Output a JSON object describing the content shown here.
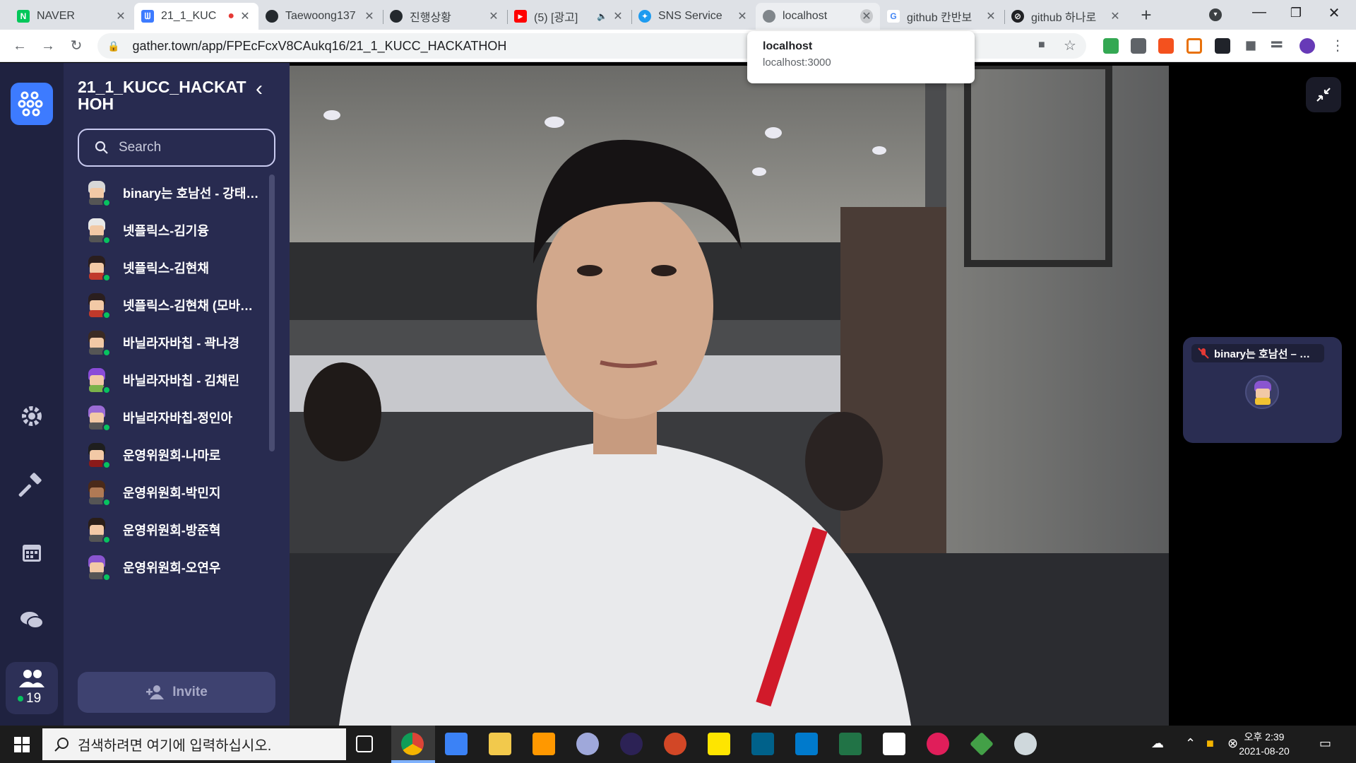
{
  "browser": {
    "tabs": [
      {
        "title": "NAVER",
        "favicon_color": "#03c75a",
        "favicon_glyph": "N"
      },
      {
        "title": "21_1_KUC",
        "favicon_color": "#3d7bff",
        "favicon_glyph": "ᗯ",
        "recording_indicator": "●"
      },
      {
        "title": "Taewoong137",
        "favicon_color": "#24292e",
        "favicon_glyph": "●"
      },
      {
        "title": "진행상황",
        "favicon_color": "#24292e",
        "favicon_glyph": "●"
      },
      {
        "title": "(5) [광고]",
        "favicon_color": "#ff0000",
        "favicon_glyph": "▶",
        "audio_icon": "🔈"
      },
      {
        "title": "SNS Service",
        "favicon_color": "#1d9bf0",
        "favicon_glyph": "✦"
      },
      {
        "title": "localhost",
        "favicon_color": "#80868b",
        "favicon_glyph": "◍"
      },
      {
        "title": "github 칸반보",
        "favicon_color": "#4285f4",
        "favicon_glyph": "G"
      },
      {
        "title": "github 하나로",
        "favicon_color": "#202124",
        "favicon_glyph": "⊘"
      }
    ],
    "new_tab_label": "+",
    "address": "gather.town/app/FPEcFcxV8CAukq16/21_1_KUCC_HACKATHOH",
    "hover_card": {
      "title": "localhost",
      "url": "localhost:3000"
    }
  },
  "gather": {
    "space_title": "21_1_KUCC_HACKATHOH",
    "search_placeholder": "Search",
    "online_count": "19",
    "invite_label": "Invite",
    "users": [
      {
        "name": "binary는 호남선 - 강태…",
        "hair": "#d7d7d7"
      },
      {
        "name": "넷플릭스-김기융",
        "hair": "#e8e8e8"
      },
      {
        "name": "넷플릭스-김현채",
        "hair": "#2a1e1e"
      },
      {
        "name": "넷플릭스-김현채 (모바…",
        "hair": "#2a1e1e"
      },
      {
        "name": "바닐라자바칩 - 곽나경",
        "hair": "#3a2a24"
      },
      {
        "name": "바닐라자바칩 - 김채린",
        "hair": "#8a4bd8"
      },
      {
        "name": "바닐라자바칩-정인아",
        "hair": "#9b6bd6"
      },
      {
        "name": "운영위원회-나마로",
        "hair": "#1e1e1e"
      },
      {
        "name": "운영위원회-박민지",
        "hair": "#4a2a1a"
      },
      {
        "name": "운영위원회-방준혁",
        "hair": "#2a1e18"
      },
      {
        "name": "운영위원회-오연우",
        "hair": "#8a55d0"
      }
    ],
    "mini_participant": {
      "label": "binary는 호남선 – …",
      "muted_icon": "mic-off"
    }
  },
  "taskbar": {
    "search_placeholder": "검색하려면 여기에 입력하십시오.",
    "time": "오후 2:39",
    "date": "2021-08-20"
  }
}
